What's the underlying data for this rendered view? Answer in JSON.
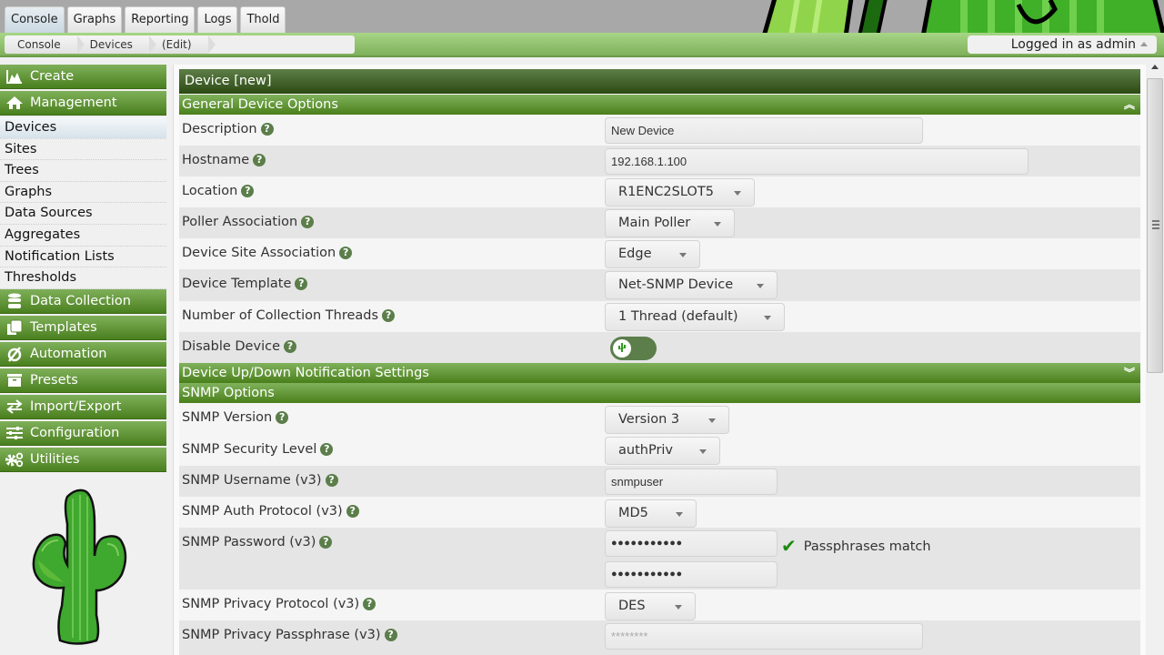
{
  "tabs": [
    {
      "label": "Console",
      "active": true
    },
    {
      "label": "Graphs",
      "active": false
    },
    {
      "label": "Reporting",
      "active": false
    },
    {
      "label": "Logs",
      "active": false
    },
    {
      "label": "Thold",
      "active": false
    }
  ],
  "breadcrumb": [
    "Console",
    "Devices",
    "(Edit)"
  ],
  "user_menu": {
    "label": "Logged in as admin"
  },
  "sidebar": {
    "create": {
      "label": "Create",
      "icon": "chart-area-icon"
    },
    "management": {
      "label": "Management",
      "icon": "home-icon"
    },
    "management_items": [
      {
        "label": "Devices",
        "selected": true
      },
      {
        "label": "Sites"
      },
      {
        "label": "Trees"
      },
      {
        "label": "Graphs"
      },
      {
        "label": "Data Sources"
      },
      {
        "label": "Aggregates"
      },
      {
        "label": "Notification Lists"
      },
      {
        "label": "Thresholds"
      }
    ],
    "sections": [
      {
        "label": "Data Collection",
        "icon": "database-icon"
      },
      {
        "label": "Templates",
        "icon": "copy-icon"
      },
      {
        "label": "Automation",
        "icon": "automation-icon"
      },
      {
        "label": "Presets",
        "icon": "archive-icon"
      },
      {
        "label": "Import/Export",
        "icon": "exchange-icon"
      },
      {
        "label": "Configuration",
        "icon": "sliders-icon"
      },
      {
        "label": "Utilities",
        "icon": "cogs-icon"
      }
    ]
  },
  "main": {
    "title": "Device [new]",
    "sections": {
      "general": "General Device Options",
      "updown": "Device Up/Down Notification Settings",
      "snmp": "SNMP Options"
    },
    "fields": {
      "description": {
        "label": "Description",
        "value": "New Device"
      },
      "hostname": {
        "label": "Hostname",
        "value": "192.168.1.100"
      },
      "location": {
        "label": "Location",
        "value": "R1ENC2SLOT5"
      },
      "poller": {
        "label": "Poller Association",
        "value": "Main Poller"
      },
      "site": {
        "label": "Device Site Association",
        "value": "Edge"
      },
      "template": {
        "label": "Device Template",
        "value": "Net-SNMP Device"
      },
      "threads": {
        "label": "Number of Collection Threads",
        "value": "1 Thread (default)"
      },
      "disable": {
        "label": "Disable Device",
        "value": false
      },
      "snmp_version": {
        "label": "SNMP Version",
        "value": "Version 3"
      },
      "snmp_security": {
        "label": "SNMP Security Level",
        "value": "authPriv"
      },
      "snmp_username": {
        "label": "SNMP Username (v3)",
        "value": "snmpuser"
      },
      "snmp_auth": {
        "label": "SNMP Auth Protocol (v3)",
        "value": "MD5"
      },
      "snmp_password": {
        "label": "SNMP Password (v3)",
        "value": "●●●●●●●●●●●",
        "confirm": "●●●●●●●●●●●",
        "match_text": "Passphrases match"
      },
      "snmp_priv_protocol": {
        "label": "SNMP Privacy Protocol (v3)",
        "value": "DES"
      },
      "snmp_priv_pass": {
        "label": "SNMP Privacy Passphrase (v3)",
        "placeholder": "********"
      }
    }
  },
  "colors": {
    "accent": "#4a7f1e",
    "header_dark": "#2c4a12",
    "help": "#5b7e4a",
    "check": "#1a8a12"
  }
}
